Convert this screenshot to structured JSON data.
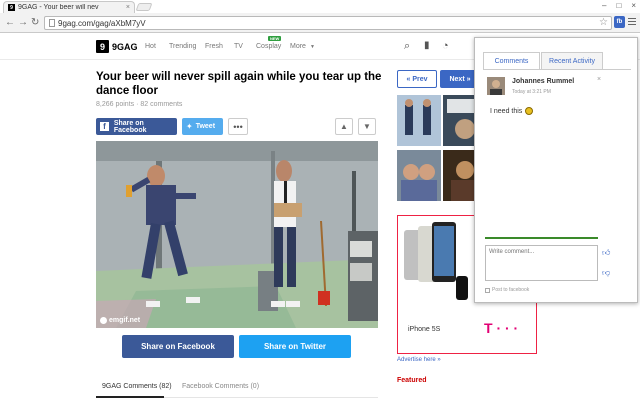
{
  "browser": {
    "tab_title": "9GAG - Your beer will nev",
    "tab_favicon": "9",
    "url": "9gag.com/gag/aXbM7yV",
    "extension_label": "fb"
  },
  "site": {
    "logo_glyph": "9",
    "logo_text": "9GAG",
    "nav": [
      "Hot",
      "Trending",
      "Fresh",
      "TV",
      "Cosplay",
      "More"
    ],
    "new_badge": "NEW"
  },
  "post": {
    "title": "Your beer will never spill again while you tear up the dance floor",
    "points": "8,266 points",
    "comments_count": "82 comments",
    "share_facebook": "Share on Facebook",
    "tweet": "Tweet",
    "more": "•••",
    "watermark": "emgif.net",
    "share_facebook_large": "Share on Facebook",
    "share_twitter_large": "Share on Twitter"
  },
  "comment_tabs": {
    "gag": "9GAG Comments (82)",
    "facebook": "Facebook Comments (0)"
  },
  "sidebar": {
    "prev": "« Prev",
    "next": "Next »",
    "advertise": "Advertise here »",
    "featured": "Featured",
    "ad_phone": "iPhone 5S",
    "ad_brand": "T · · ·"
  },
  "popup": {
    "tab_comments": "Comments",
    "tab_recent": "Recent Activity",
    "author": "Johannes Rummel",
    "time": "Today at 3:21 PM",
    "close": "×",
    "comment": "I need this",
    "input_placeholder": "Write comment...",
    "post_to_facebook": "Post to facebook"
  },
  "colors": {
    "facebook": "#3b5998",
    "twitter": "#55acee",
    "accent": "#3b67c4"
  }
}
